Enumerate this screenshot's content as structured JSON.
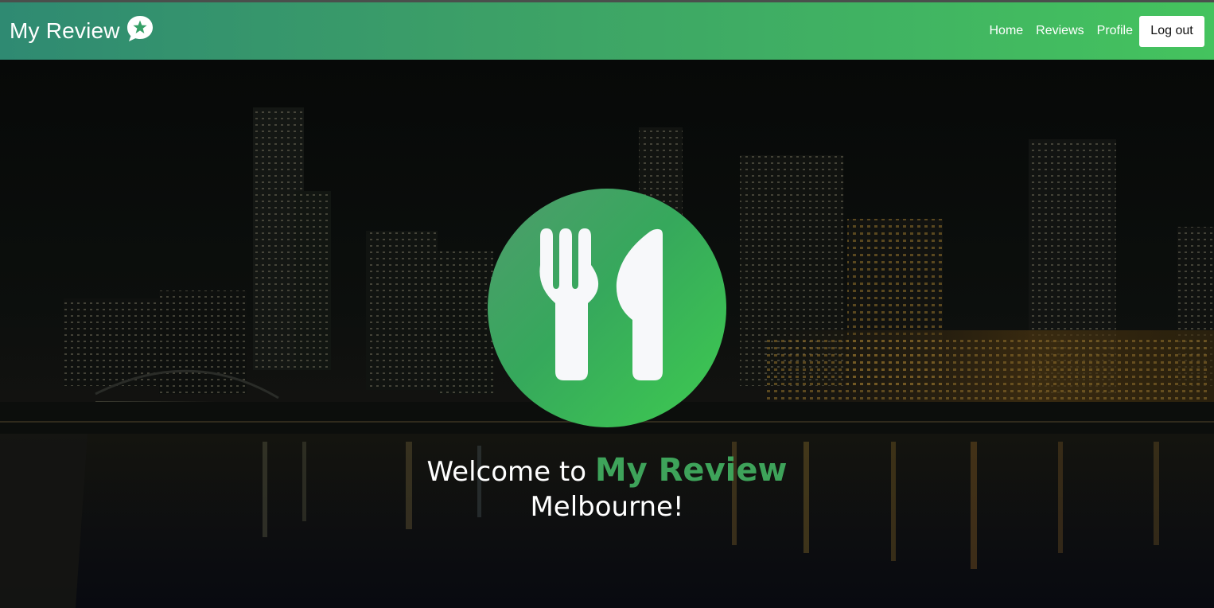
{
  "navbar": {
    "brand": "My Review",
    "brand_icon": "star-speech-bubble-icon",
    "links": [
      "Home",
      "Reviews",
      "Profile"
    ],
    "logout_label": "Log out",
    "gradient": [
      "#2f8a72",
      "#44c35e"
    ]
  },
  "hero": {
    "background": "night-city-skyline-river",
    "logo_icon": "fork-knife-icon",
    "welcome_prefix": "Welcome to",
    "welcome_brand": "My Review",
    "welcome_city": "Melbourne!",
    "accent": "#3ea35a"
  }
}
